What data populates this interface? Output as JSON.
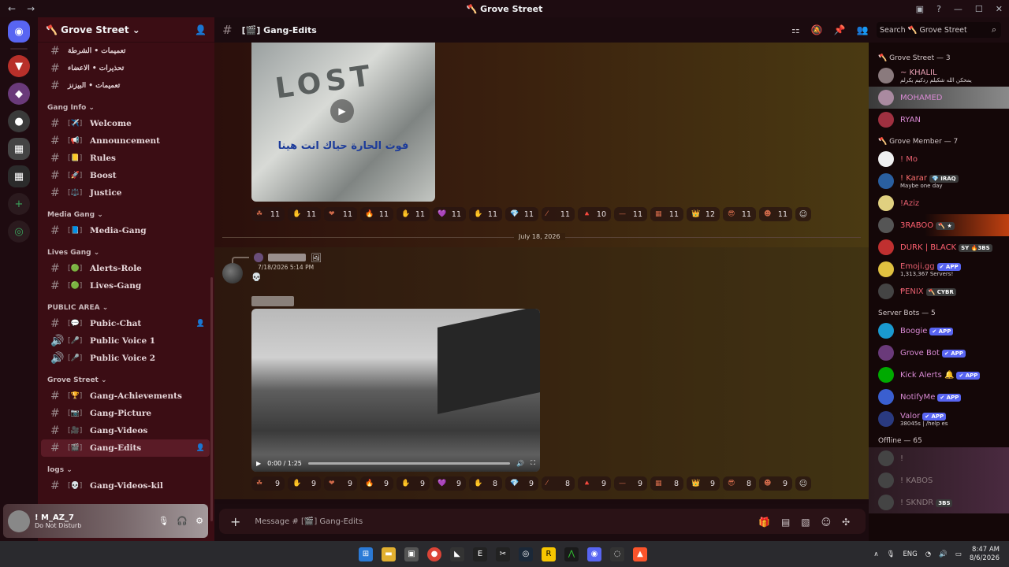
{
  "window": {
    "title": "🪓 Grove Street",
    "back": "←",
    "forward": "→"
  },
  "server": {
    "name": "🪓 Grove Street ⌄"
  },
  "channel_list": {
    "top_items": [
      {
        "name": "تعميمات • الشرطة"
      },
      {
        "name": "تحذيرات • الاعضاء"
      },
      {
        "name": "تعميمات • البيزنز"
      }
    ],
    "categories": [
      {
        "label": "Gang Info ⌄",
        "channels": [
          {
            "icon": "#",
            "emoji": "[✈️]",
            "name": "Welcome"
          },
          {
            "icon": "#",
            "emoji": "[📢]",
            "name": "Announcement"
          },
          {
            "icon": "#",
            "emoji": "[📒]",
            "name": "Rules"
          },
          {
            "icon": "#",
            "emoji": "[🚀]",
            "name": "Boost"
          },
          {
            "icon": "#",
            "emoji": "[⚖️]",
            "name": "Justice"
          }
        ]
      },
      {
        "label": "Media Gang ⌄",
        "channels": [
          {
            "icon": "#",
            "emoji": "[📘]",
            "name": "Media-Gang"
          }
        ]
      },
      {
        "label": "Lives Gang ⌄",
        "channels": [
          {
            "icon": "#",
            "emoji": "[🟢]",
            "name": "Alerts-Role"
          },
          {
            "icon": "#",
            "emoji": "[🟢]",
            "name": "Lives-Gang"
          }
        ]
      },
      {
        "label": "PUBLIC AREA ⌄",
        "channels": [
          {
            "icon": "#",
            "emoji": "[💬]",
            "name": "Pubic-Chat"
          },
          {
            "icon": "🔊",
            "emoji": "[🎤]",
            "name": "Public Voice 1"
          },
          {
            "icon": "🔊",
            "emoji": "[🎤]",
            "name": "Public Voice 2"
          }
        ]
      },
      {
        "label": "Grove Street ⌄",
        "channels": [
          {
            "icon": "#",
            "emoji": "[🏆]",
            "name": "Gang-Achievements"
          },
          {
            "icon": "#",
            "emoji": "[📷]",
            "name": "Gang-Picture"
          },
          {
            "icon": "#",
            "emoji": "[🎥]",
            "name": "Gang-Videos"
          },
          {
            "icon": "#",
            "emoji": "[🎬]",
            "name": "Gang-Edits"
          }
        ]
      },
      {
        "label": "logs ⌄",
        "channels": [
          {
            "icon": "#",
            "emoji": "[💀]",
            "name": "Gang-Videos-kil"
          }
        ]
      }
    ]
  },
  "user": {
    "name": "! M_AZ_7",
    "status": "Do Not Disturb"
  },
  "chat_header": {
    "channel": "[🎬] Gang-Edits",
    "search_placeholder": "Search 🪓 Grove Street"
  },
  "messages": {
    "video1_caption": "فوت الحارة حياك انت هينا",
    "video1_graffiti": "LOST",
    "reactions1": [
      "11",
      "11",
      "11",
      "11",
      "11",
      "11",
      "11",
      "11",
      "11",
      "10",
      "11",
      "11",
      "12",
      "11",
      "11"
    ],
    "date_divider": "July 18, 2026",
    "timestamp": "7/18/2026 5:14 PM",
    "video2_time": "0:00 / 1:25",
    "reactions2": [
      "9",
      "9",
      "9",
      "9",
      "9",
      "9",
      "8",
      "9",
      "8",
      "9",
      "9",
      "8",
      "9",
      "8",
      "9"
    ]
  },
  "composer": {
    "placeholder": "Message # [🎬] Gang-Edits",
    "plus": "+"
  },
  "member_list": {
    "groups": [
      {
        "label": "🪓 Grove Street — 3",
        "members": [
          {
            "name": "~ KHALIL",
            "sub": "يمحكن الله شكيلم ردكيم يكرلم",
            "color": "#e8a0b4"
          },
          {
            "name": "MOHAMED",
            "sub": "",
            "color": "#d98ad4"
          },
          {
            "name": "RYAN",
            "sub": "",
            "color": "#d98ad4"
          }
        ]
      },
      {
        "label": "🪓 Grove Member — 7",
        "members": [
          {
            "name": "! Mo",
            "sub": "",
            "color": "#e86070"
          },
          {
            "name": "! Karar",
            "tag": "💎 IRAQ",
            "sub": "Maybe one day",
            "color": "#ff7070"
          },
          {
            "name": "!Aziz",
            "sub": "",
            "color": "#e86070"
          },
          {
            "name": "3RABOO",
            "tag": "🪓 ★",
            "sub": "",
            "color": "#ff6070"
          },
          {
            "name": "DURK | BLACK",
            "tag": "SY 🔥3BS",
            "sub": "",
            "color": "#ff6070"
          },
          {
            "name": "Emoji.gg",
            "tag": "✔ APP",
            "sub": "1,313,367 Servers!",
            "color": "#e86070"
          },
          {
            "name": "ⱣENIX",
            "tag": "🪓 CYBR",
            "sub": "",
            "color": "#e86070"
          }
        ]
      },
      {
        "label": "Server Bots — 5",
        "members": [
          {
            "name": "Boogie",
            "tag": "✔ APP",
            "sub": "",
            "color": "#d98ad4"
          },
          {
            "name": "Grove Bot",
            "tag": "✔ APP",
            "sub": "",
            "color": "#d98ad4"
          },
          {
            "name": "Kick Alerts 🔔",
            "tag": "✔ APP",
            "sub": "",
            "color": "#d98ad4"
          },
          {
            "name": "NotifyMe",
            "tag": "✔ APP",
            "sub": "",
            "color": "#d98ad4"
          },
          {
            "name": "Valor",
            "tag": "✔ APP",
            "sub": "38045s | /help es",
            "color": "#d98ad4"
          }
        ]
      },
      {
        "label": "Offline — 65",
        "members": [
          {
            "name": "!",
            "sub": "",
            "color": "#8a7a7d"
          },
          {
            "name": "! KABOS",
            "sub": "",
            "color": "#8a7a7d"
          },
          {
            "name": "! SKNDR",
            "tag": "3BS",
            "sub": "",
            "color": "#8a7a7d"
          }
        ]
      }
    ]
  },
  "taskbar": {
    "lang": "ENG",
    "time": "8:47 AM",
    "date": "8/6/2026",
    "chevron": "∧"
  }
}
